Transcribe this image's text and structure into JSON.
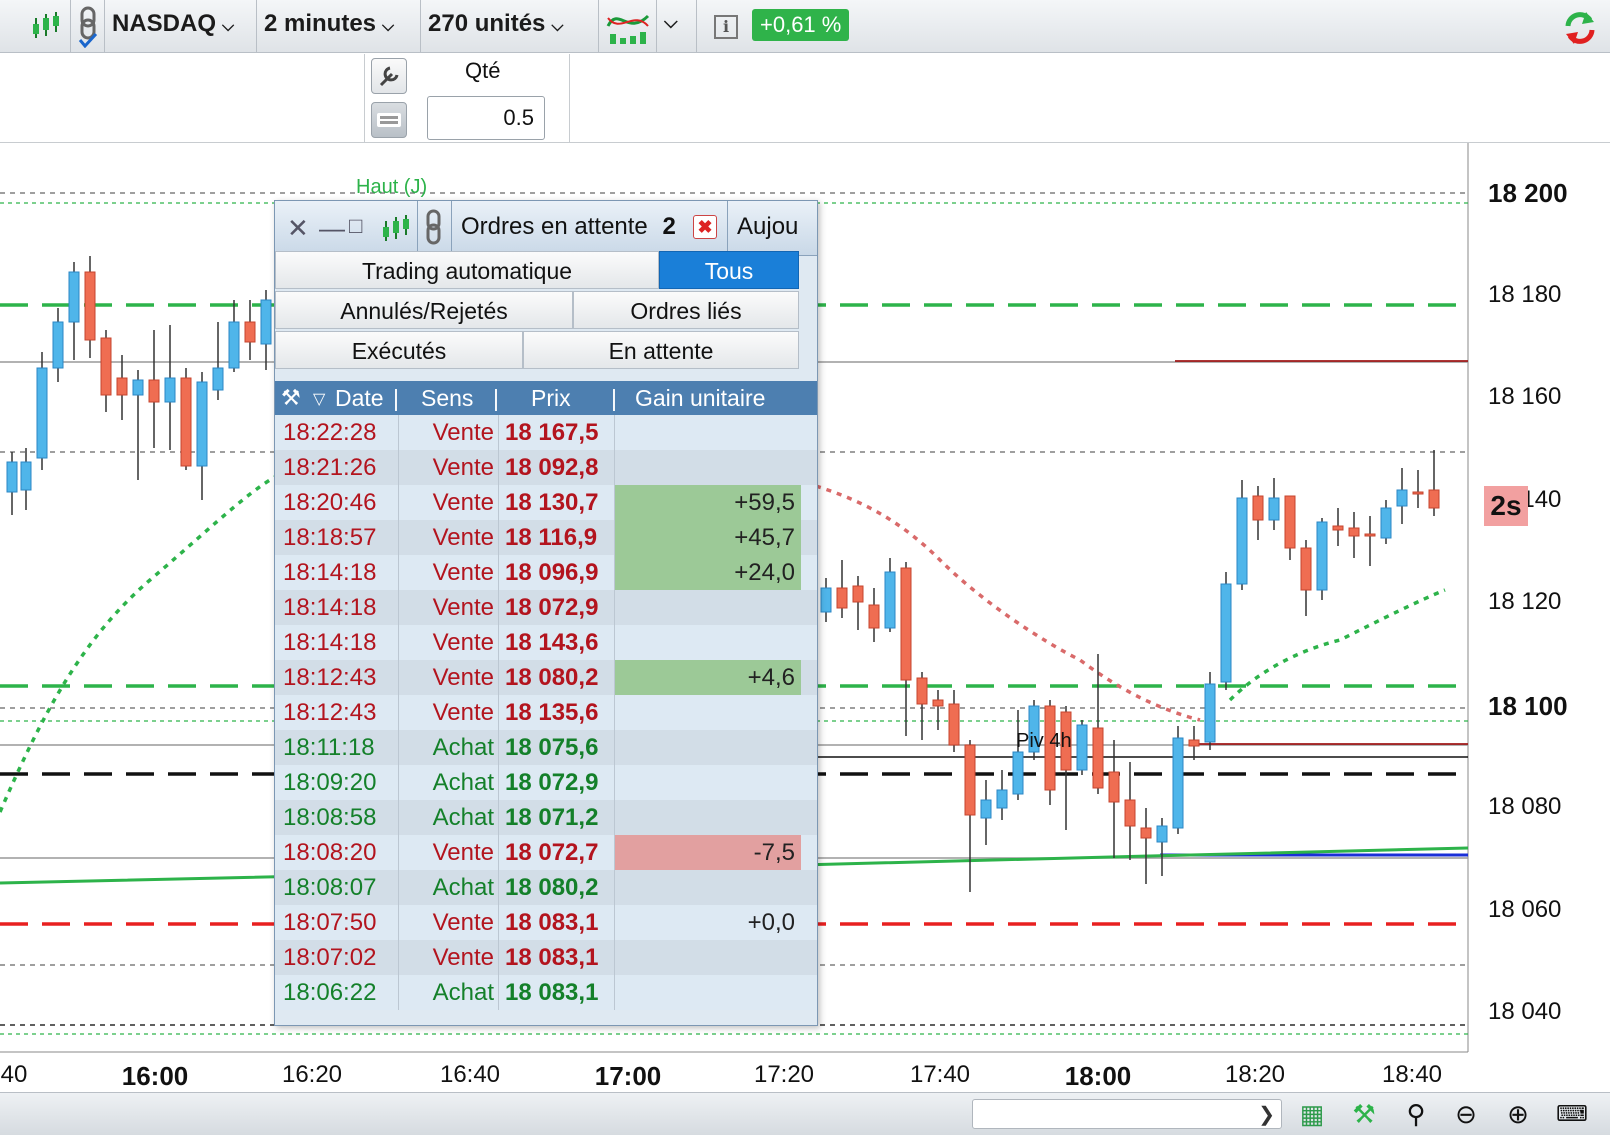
{
  "toolbar": {
    "instrument": "NASDAQ",
    "timeframe": "2 minutes",
    "units": "270 unités",
    "performance": "+0,61 %",
    "info_icon": "i"
  },
  "ticket": {
    "qty_label": "Qté",
    "qty_value": "0.5"
  },
  "chart": {
    "price_axis": [
      "18 200",
      "18 180",
      "18 160",
      "18 140",
      "18 120",
      "18 100",
      "18 080",
      "18 060",
      "18 040"
    ],
    "time_axis": [
      "40",
      "16:00",
      "16:20",
      "16:40",
      "17:00",
      "17:20",
      "17:40",
      "18:00",
      "18:20",
      "18:40"
    ],
    "annotation_high": "Haut (J)",
    "annotation_pivot": "Piv 4h",
    "refresh_timer": "2s",
    "colors": {
      "up": "#4fb5ea",
      "down": "#ef6d52",
      "support": "#2db34a",
      "resistance": "#e82020"
    }
  },
  "orders_window": {
    "title": "Ordres en attente",
    "count": "2",
    "next_tab": "Aujou",
    "tabs": [
      {
        "label": "Trading automatique",
        "active": false
      },
      {
        "label": "Tous",
        "active": true
      },
      {
        "label": "Annulés/Rejetés",
        "active": false
      },
      {
        "label": "Ordres liés",
        "active": false
      },
      {
        "label": "Exécutés",
        "active": false
      },
      {
        "label": "En attente",
        "active": false
      }
    ],
    "columns": {
      "date": "Date",
      "sens": "Sens",
      "prix": "Prix",
      "gain": "Gain unitaire"
    },
    "rows": [
      {
        "date": "18:22:28",
        "sens": "Vente",
        "prix": "18 167,5",
        "gain": ""
      },
      {
        "date": "18:21:26",
        "sens": "Vente",
        "prix": "18 092,8",
        "gain": ""
      },
      {
        "date": "18:20:46",
        "sens": "Vente",
        "prix": "18 130,7",
        "gain": "+59,5"
      },
      {
        "date": "18:18:57",
        "sens": "Vente",
        "prix": "18 116,9",
        "gain": "+45,7"
      },
      {
        "date": "18:14:18",
        "sens": "Vente",
        "prix": "18 096,9",
        "gain": "+24,0"
      },
      {
        "date": "18:14:18",
        "sens": "Vente",
        "prix": "18 072,9",
        "gain": ""
      },
      {
        "date": "18:14:18",
        "sens": "Vente",
        "prix": "18 143,6",
        "gain": ""
      },
      {
        "date": "18:12:43",
        "sens": "Vente",
        "prix": "18 080,2",
        "gain": "+4,6"
      },
      {
        "date": "18:12:43",
        "sens": "Vente",
        "prix": "18 135,6",
        "gain": ""
      },
      {
        "date": "18:11:18",
        "sens": "Achat",
        "prix": "18 075,6",
        "gain": ""
      },
      {
        "date": "18:09:20",
        "sens": "Achat",
        "prix": "18 072,9",
        "gain": ""
      },
      {
        "date": "18:08:58",
        "sens": "Achat",
        "prix": "18 071,2",
        "gain": ""
      },
      {
        "date": "18:08:20",
        "sens": "Vente",
        "prix": "18 072,7",
        "gain": "-7,5"
      },
      {
        "date": "18:08:07",
        "sens": "Achat",
        "prix": "18 080,2",
        "gain": ""
      },
      {
        "date": "18:07:50",
        "sens": "Vente",
        "prix": "18 083,1",
        "gain": "+0,0"
      },
      {
        "date": "18:07:02",
        "sens": "Vente",
        "prix": "18 083,1",
        "gain": ""
      },
      {
        "date": "18:06:22",
        "sens": "Achat",
        "prix": "18 083,1",
        "gain": ""
      }
    ]
  },
  "bottombar": {
    "icons": [
      "calendar-icon",
      "tools-icon",
      "zoom-fit-icon",
      "zoom-out-icon",
      "zoom-in-icon",
      "keyboard-icon"
    ]
  }
}
